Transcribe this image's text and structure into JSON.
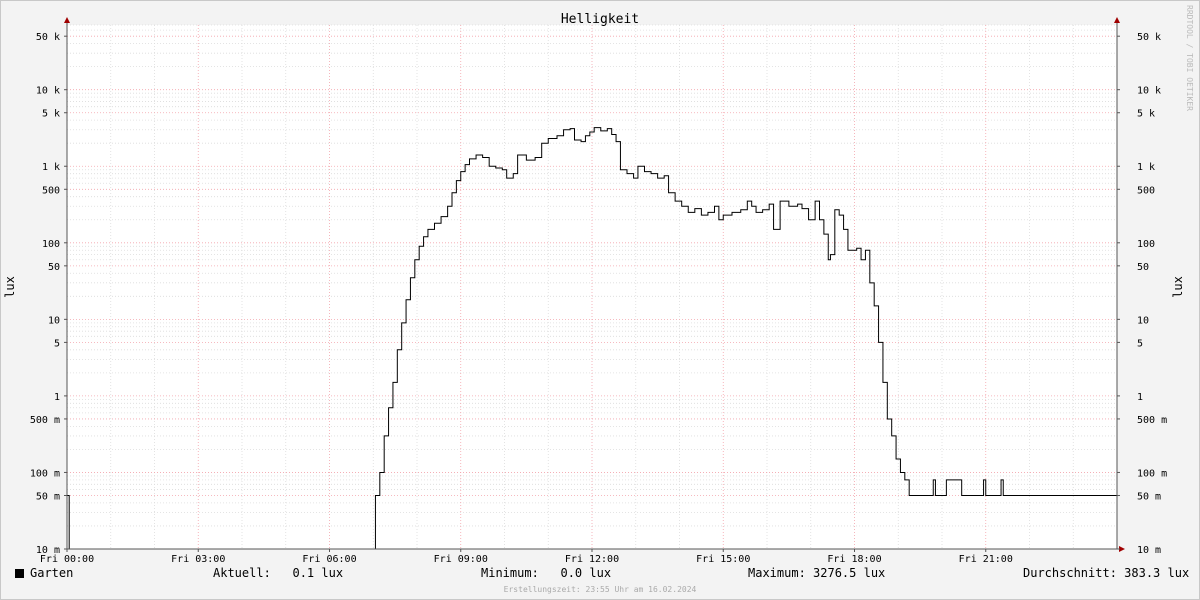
{
  "watermark": "RRDTOOL / TOBI OETIKER",
  "chart_data": {
    "type": "line",
    "title": "Helligkeit",
    "ylabel_left": "lux",
    "ylabel_right": "lux",
    "yscale": "log",
    "ylim": [
      0.01,
      70000
    ],
    "xlim_hours": [
      0,
      24
    ],
    "y_ticks": [
      {
        "v": 0.01,
        "label": "10 m"
      },
      {
        "v": 0.05,
        "label": "50 m"
      },
      {
        "v": 0.1,
        "label": "100 m"
      },
      {
        "v": 0.5,
        "label": "500 m"
      },
      {
        "v": 1,
        "label": "1"
      },
      {
        "v": 5,
        "label": "5"
      },
      {
        "v": 10,
        "label": "10"
      },
      {
        "v": 50,
        "label": "50"
      },
      {
        "v": 100,
        "label": "100"
      },
      {
        "v": 500,
        "label": "500"
      },
      {
        "v": 1000,
        "label": "1 k"
      },
      {
        "v": 5000,
        "label": "5 k"
      },
      {
        "v": 10000,
        "label": "10 k"
      },
      {
        "v": 50000,
        "label": "50 k"
      }
    ],
    "x_ticks": [
      {
        "h": 0,
        "label": "Fri 00:00"
      },
      {
        "h": 3,
        "label": "Fri 03:00"
      },
      {
        "h": 6,
        "label": "Fri 06:00"
      },
      {
        "h": 9,
        "label": "Fri 09:00"
      },
      {
        "h": 12,
        "label": "Fri 12:00"
      },
      {
        "h": 15,
        "label": "Fri 15:00"
      },
      {
        "h": 18,
        "label": "Fri 18:00"
      },
      {
        "h": 21,
        "label": "Fri 21:00"
      }
    ],
    "series": [
      {
        "name": "Garten",
        "color": "#000000",
        "points": [
          [
            0.0,
            0.05
          ],
          [
            0.05,
            0.01
          ],
          [
            7.0,
            0.01
          ],
          [
            7.05,
            0.05
          ],
          [
            7.15,
            0.1
          ],
          [
            7.25,
            0.3
          ],
          [
            7.35,
            0.7
          ],
          [
            7.45,
            1.5
          ],
          [
            7.55,
            4
          ],
          [
            7.65,
            9
          ],
          [
            7.75,
            18
          ],
          [
            7.85,
            35
          ],
          [
            7.95,
            60
          ],
          [
            8.05,
            90
          ],
          [
            8.15,
            120
          ],
          [
            8.25,
            150
          ],
          [
            8.4,
            180
          ],
          [
            8.55,
            220
          ],
          [
            8.7,
            300
          ],
          [
            8.8,
            450
          ],
          [
            8.9,
            650
          ],
          [
            9.0,
            850
          ],
          [
            9.1,
            1050
          ],
          [
            9.2,
            1250
          ],
          [
            9.35,
            1400
          ],
          [
            9.5,
            1300
          ],
          [
            9.65,
            1000
          ],
          [
            9.8,
            950
          ],
          [
            9.95,
            900
          ],
          [
            10.05,
            700
          ],
          [
            10.2,
            800
          ],
          [
            10.3,
            1400
          ],
          [
            10.5,
            1200
          ],
          [
            10.7,
            1300
          ],
          [
            10.85,
            2000
          ],
          [
            11.0,
            2300
          ],
          [
            11.2,
            2500
          ],
          [
            11.35,
            3000
          ],
          [
            11.5,
            3100
          ],
          [
            11.6,
            2200
          ],
          [
            11.75,
            2100
          ],
          [
            11.85,
            2500
          ],
          [
            11.95,
            2800
          ],
          [
            12.05,
            3200
          ],
          [
            12.2,
            2900
          ],
          [
            12.35,
            3100
          ],
          [
            12.45,
            2600
          ],
          [
            12.55,
            2100
          ],
          [
            12.65,
            900
          ],
          [
            12.8,
            800
          ],
          [
            12.95,
            700
          ],
          [
            13.05,
            1000
          ],
          [
            13.2,
            850
          ],
          [
            13.35,
            800
          ],
          [
            13.5,
            700
          ],
          [
            13.65,
            750
          ],
          [
            13.75,
            450
          ],
          [
            13.9,
            350
          ],
          [
            14.05,
            300
          ],
          [
            14.2,
            250
          ],
          [
            14.35,
            280
          ],
          [
            14.5,
            230
          ],
          [
            14.65,
            250
          ],
          [
            14.8,
            300
          ],
          [
            14.9,
            200
          ],
          [
            15.0,
            230
          ],
          [
            15.2,
            250
          ],
          [
            15.4,
            270
          ],
          [
            15.55,
            350
          ],
          [
            15.65,
            300
          ],
          [
            15.75,
            250
          ],
          [
            15.9,
            270
          ],
          [
            16.05,
            320
          ],
          [
            16.15,
            150
          ],
          [
            16.3,
            350
          ],
          [
            16.5,
            300
          ],
          [
            16.7,
            320
          ],
          [
            16.8,
            280
          ],
          [
            16.95,
            200
          ],
          [
            17.1,
            350
          ],
          [
            17.2,
            200
          ],
          [
            17.3,
            130
          ],
          [
            17.4,
            60
          ],
          [
            17.45,
            70
          ],
          [
            17.55,
            270
          ],
          [
            17.65,
            230
          ],
          [
            17.75,
            150
          ],
          [
            17.85,
            80
          ],
          [
            18.05,
            85
          ],
          [
            18.15,
            60
          ],
          [
            18.25,
            80
          ],
          [
            18.35,
            30
          ],
          [
            18.45,
            15
          ],
          [
            18.55,
            5
          ],
          [
            18.65,
            1.5
          ],
          [
            18.75,
            0.5
          ],
          [
            18.85,
            0.3
          ],
          [
            18.95,
            0.15
          ],
          [
            19.05,
            0.1
          ],
          [
            19.15,
            0.08
          ],
          [
            19.25,
            0.05
          ],
          [
            19.7,
            0.05
          ],
          [
            19.8,
            0.08
          ],
          [
            19.85,
            0.05
          ],
          [
            20.1,
            0.08
          ],
          [
            20.45,
            0.05
          ],
          [
            20.95,
            0.08
          ],
          [
            21.0,
            0.05
          ],
          [
            21.35,
            0.08
          ],
          [
            21.4,
            0.05
          ],
          [
            24.0,
            0.05
          ]
        ]
      }
    ],
    "legend": {
      "series_name": "Garten",
      "aktuell": "Aktuell:   0.1 lux",
      "minimum": "Minimum:   0.0 lux",
      "maximum": "Maximum: 3276.5 lux",
      "durchschnitt": "Durchschnitt: 383.3 lux"
    },
    "footer": "Erstellungszeit: 23:55 Uhr am 16.02.2024"
  }
}
